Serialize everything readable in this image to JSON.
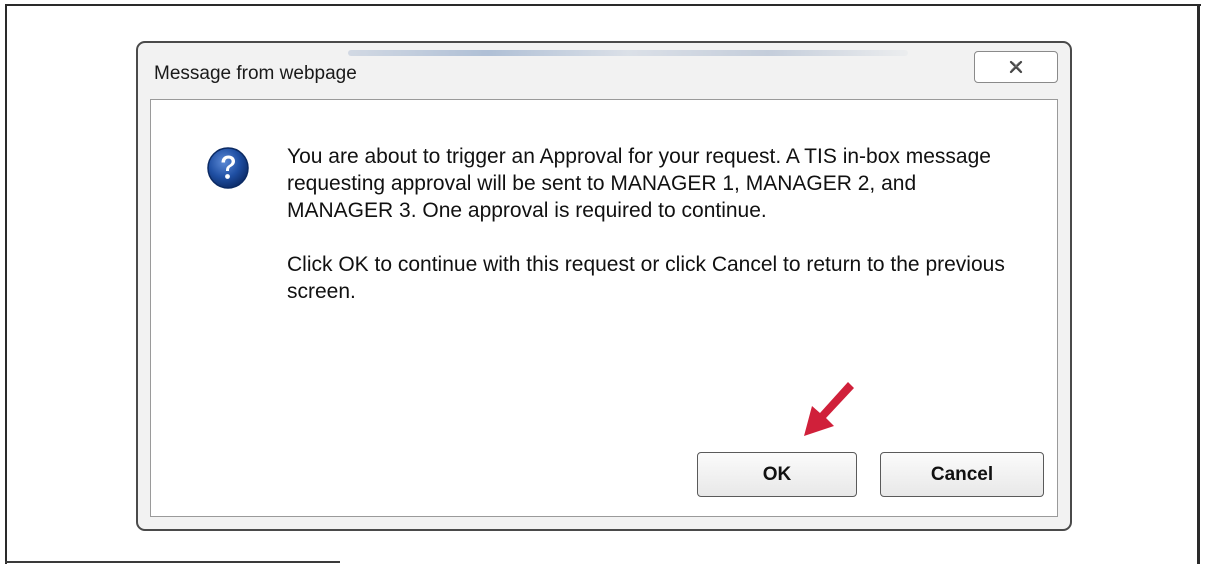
{
  "dialog": {
    "title": "Message from webpage",
    "close_glyph": "✕",
    "icon": "question-icon",
    "message_paragraphs": [
      "You are about to trigger an Approval for your request. A TIS in-box message requesting approval will be sent to MANAGER 1, MANAGER 2, and MANAGER 3. One approval is required to continue.",
      "Click OK to continue with this request or click Cancel to return to the previous screen."
    ],
    "ok_label": "OK",
    "cancel_label": "Cancel"
  },
  "annotation": {
    "arrow_icon": "red-arrow-pointer-icon",
    "arrow_color": "#d0203a"
  },
  "colors": {
    "icon_blue": "#1f4fa3",
    "dialog_border": "#4a4a4a"
  }
}
